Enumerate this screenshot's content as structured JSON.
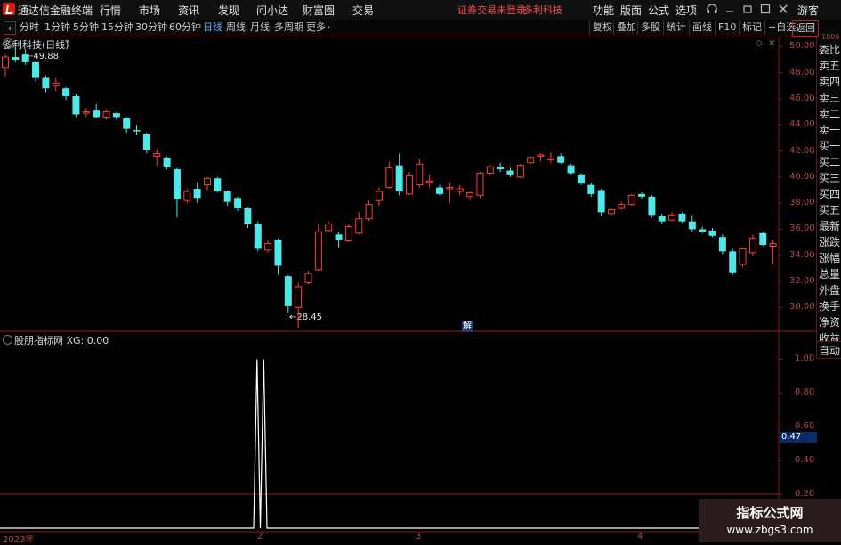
{
  "titlebar": {
    "app_name": "通达信金融终端",
    "menus": [
      "行情",
      "市场",
      "资讯",
      "发现",
      "问小达",
      "财富圈",
      "交易"
    ],
    "warning": "证券交易未登录",
    "stock_name": "多利科技",
    "right_menus": [
      "功能",
      "版面",
      "公式",
      "选项"
    ],
    "guest": "游客",
    "icons": [
      "headset-icon",
      "minimize-icon",
      "restore-icon",
      "close-icon"
    ]
  },
  "toolbar": {
    "back_icon": "‹",
    "periods": [
      "分时",
      "1分钟",
      "5分钟",
      "15分钟",
      "30分钟",
      "60分钟",
      "日线",
      "周线",
      "月线",
      "多周期",
      "更多"
    ],
    "active_period": "日线",
    "right_tools": [
      "复权",
      "叠加",
      "多股",
      "统计",
      "画线",
      "F10",
      "标记",
      "+自选",
      "返回"
    ]
  },
  "main_chart": {
    "title": "多利科技(日线)",
    "high_marker": "49.88",
    "low_marker": "28.45",
    "center_label": "解",
    "y_ticks": [
      "50.00",
      "48.00",
      "46.00",
      "44.00",
      "42.00",
      "40.00",
      "38.00",
      "36.00",
      "34.00",
      "32.00",
      "30.00"
    ]
  },
  "indicator": {
    "title": "股朋指标网 XG: 0.00",
    "y_ticks": [
      "1.00",
      "0.80",
      "0.60",
      "0.40",
      "0.20"
    ],
    "current_value": "0.47"
  },
  "x_axis": {
    "labels": [
      "2023年",
      "2",
      "3",
      "4"
    ]
  },
  "side_panel": {
    "top_label": "1000",
    "items": [
      "委比",
      "卖五",
      "卖四",
      "卖三",
      "卖二",
      "卖一",
      "买一",
      "买二",
      "买三",
      "买四",
      "买五",
      "最新",
      "涨跌",
      "涨幅",
      "总量",
      "外盘",
      "换手",
      "净资",
      "收益"
    ],
    "auto_button": "自动"
  },
  "watermark": {
    "title": "指标公式网",
    "url": "www.zbgs3.com"
  },
  "colors": {
    "up": "#ff3c3c",
    "down": "#4ee8e8",
    "axis": "#8b1a1a",
    "line": "#ffffff"
  },
  "chart_data": [
    {
      "type": "candlestick",
      "title": "多利科技(日线)",
      "ylim": [
        29,
        50.5
      ],
      "candles": [
        {
          "o": 48.4,
          "h": 49.4,
          "l": 47.7,
          "c": 49.2
        },
        {
          "o": 49.2,
          "h": 49.88,
          "l": 48.8,
          "c": 49.0
        },
        {
          "o": 49.4,
          "h": 49.8,
          "l": 48.6,
          "c": 48.8
        },
        {
          "o": 48.8,
          "h": 48.9,
          "l": 47.3,
          "c": 47.6
        },
        {
          "o": 47.6,
          "h": 47.8,
          "l": 46.5,
          "c": 46.8
        },
        {
          "o": 47.0,
          "h": 47.6,
          "l": 46.6,
          "c": 47.2
        },
        {
          "o": 46.8,
          "h": 46.9,
          "l": 45.9,
          "c": 46.2
        },
        {
          "o": 46.2,
          "h": 46.4,
          "l": 44.6,
          "c": 44.8
        },
        {
          "o": 44.9,
          "h": 45.3,
          "l": 44.6,
          "c": 45.0
        },
        {
          "o": 45.1,
          "h": 45.6,
          "l": 44.5,
          "c": 44.6
        },
        {
          "o": 44.6,
          "h": 45.2,
          "l": 44.4,
          "c": 45.0
        },
        {
          "o": 44.9,
          "h": 45.0,
          "l": 44.4,
          "c": 44.6
        },
        {
          "o": 44.5,
          "h": 44.6,
          "l": 43.4,
          "c": 43.7
        },
        {
          "o": 43.6,
          "h": 44.0,
          "l": 43.2,
          "c": 43.5
        },
        {
          "o": 43.3,
          "h": 43.4,
          "l": 41.8,
          "c": 42.1
        },
        {
          "o": 41.6,
          "h": 42.2,
          "l": 40.9,
          "c": 41.8
        },
        {
          "o": 41.5,
          "h": 41.6,
          "l": 40.6,
          "c": 40.8
        },
        {
          "o": 40.6,
          "h": 40.7,
          "l": 36.9,
          "c": 38.3
        },
        {
          "o": 38.2,
          "h": 39.1,
          "l": 38.0,
          "c": 38.9
        },
        {
          "o": 39.1,
          "h": 39.6,
          "l": 38.0,
          "c": 38.4
        },
        {
          "o": 39.4,
          "h": 40.0,
          "l": 39.0,
          "c": 39.9
        },
        {
          "o": 39.9,
          "h": 40.0,
          "l": 38.8,
          "c": 38.9
        },
        {
          "o": 38.9,
          "h": 39.0,
          "l": 37.8,
          "c": 38.1
        },
        {
          "o": 38.4,
          "h": 38.5,
          "l": 37.4,
          "c": 37.6
        },
        {
          "o": 37.6,
          "h": 37.7,
          "l": 36.1,
          "c": 36.4
        },
        {
          "o": 36.4,
          "h": 36.6,
          "l": 34.3,
          "c": 34.5
        },
        {
          "o": 34.4,
          "h": 35.2,
          "l": 34.2,
          "c": 34.9
        },
        {
          "o": 35.2,
          "h": 35.3,
          "l": 32.5,
          "c": 33.2
        },
        {
          "o": 32.4,
          "h": 32.5,
          "l": 29.6,
          "c": 30.1
        },
        {
          "o": 30.0,
          "h": 31.9,
          "l": 28.45,
          "c": 31.6
        },
        {
          "o": 31.9,
          "h": 32.8,
          "l": 31.8,
          "c": 32.6
        },
        {
          "o": 32.9,
          "h": 36.4,
          "l": 32.8,
          "c": 35.8
        },
        {
          "o": 35.9,
          "h": 36.6,
          "l": 35.8,
          "c": 36.4
        },
        {
          "o": 35.6,
          "h": 35.8,
          "l": 34.6,
          "c": 35.2
        },
        {
          "o": 35.1,
          "h": 36.4,
          "l": 35.0,
          "c": 36.2
        },
        {
          "o": 35.7,
          "h": 37.3,
          "l": 35.6,
          "c": 36.8
        },
        {
          "o": 36.8,
          "h": 38.2,
          "l": 36.6,
          "c": 37.9
        },
        {
          "o": 38.2,
          "h": 39.2,
          "l": 37.8,
          "c": 38.9
        },
        {
          "o": 39.2,
          "h": 41.2,
          "l": 39.1,
          "c": 40.7
        },
        {
          "o": 40.9,
          "h": 41.8,
          "l": 38.6,
          "c": 38.9
        },
        {
          "o": 38.7,
          "h": 40.4,
          "l": 38.6,
          "c": 40.1
        },
        {
          "o": 39.4,
          "h": 41.4,
          "l": 39.2,
          "c": 41.0
        },
        {
          "o": 39.6,
          "h": 40.2,
          "l": 39.2,
          "c": 39.7
        },
        {
          "o": 39.2,
          "h": 39.4,
          "l": 38.6,
          "c": 38.7
        },
        {
          "o": 39.1,
          "h": 39.6,
          "l": 38.0,
          "c": 39.2
        },
        {
          "o": 38.9,
          "h": 39.4,
          "l": 38.6,
          "c": 39.1
        },
        {
          "o": 38.5,
          "h": 38.9,
          "l": 38.2,
          "c": 38.8
        },
        {
          "o": 38.6,
          "h": 40.4,
          "l": 38.4,
          "c": 40.3
        },
        {
          "o": 40.3,
          "h": 40.9,
          "l": 40.1,
          "c": 40.8
        },
        {
          "o": 40.8,
          "h": 41.1,
          "l": 40.4,
          "c": 40.6
        },
        {
          "o": 40.5,
          "h": 40.7,
          "l": 40.0,
          "c": 40.2
        },
        {
          "o": 40.0,
          "h": 41.0,
          "l": 39.9,
          "c": 40.9
        },
        {
          "o": 41.1,
          "h": 41.6,
          "l": 41.0,
          "c": 41.5
        },
        {
          "o": 41.6,
          "h": 41.8,
          "l": 41.2,
          "c": 41.7
        },
        {
          "o": 41.4,
          "h": 41.9,
          "l": 41.1,
          "c": 41.4
        },
        {
          "o": 41.6,
          "h": 41.8,
          "l": 41.0,
          "c": 41.1
        },
        {
          "o": 40.9,
          "h": 41.0,
          "l": 40.2,
          "c": 40.3
        },
        {
          "o": 40.2,
          "h": 40.3,
          "l": 39.4,
          "c": 39.5
        },
        {
          "o": 39.4,
          "h": 39.6,
          "l": 38.5,
          "c": 38.7
        },
        {
          "o": 39.0,
          "h": 39.1,
          "l": 37.0,
          "c": 37.3
        },
        {
          "o": 37.2,
          "h": 37.6,
          "l": 37.1,
          "c": 37.5
        },
        {
          "o": 37.6,
          "h": 38.1,
          "l": 37.5,
          "c": 37.9
        },
        {
          "o": 37.9,
          "h": 38.7,
          "l": 37.8,
          "c": 38.6
        },
        {
          "o": 38.7,
          "h": 38.8,
          "l": 38.3,
          "c": 38.5
        },
        {
          "o": 38.5,
          "h": 38.6,
          "l": 36.9,
          "c": 37.1
        },
        {
          "o": 37.0,
          "h": 37.2,
          "l": 36.4,
          "c": 36.6
        },
        {
          "o": 36.7,
          "h": 37.3,
          "l": 36.6,
          "c": 37.1
        },
        {
          "o": 37.2,
          "h": 37.3,
          "l": 36.5,
          "c": 36.6
        },
        {
          "o": 36.6,
          "h": 37.1,
          "l": 35.8,
          "c": 36.0
        },
        {
          "o": 36.0,
          "h": 36.2,
          "l": 35.7,
          "c": 35.8
        },
        {
          "o": 35.9,
          "h": 36.1,
          "l": 35.4,
          "c": 35.5
        },
        {
          "o": 35.4,
          "h": 35.6,
          "l": 34.1,
          "c": 34.3
        },
        {
          "o": 34.3,
          "h": 34.5,
          "l": 32.5,
          "c": 32.7
        },
        {
          "o": 33.3,
          "h": 34.6,
          "l": 33.1,
          "c": 34.5
        },
        {
          "o": 34.2,
          "h": 35.6,
          "l": 33.9,
          "c": 35.3
        },
        {
          "o": 35.7,
          "h": 35.8,
          "l": 34.7,
          "c": 34.8
        },
        {
          "o": 34.7,
          "h": 35.2,
          "l": 33.3,
          "c": 34.9
        }
      ]
    },
    {
      "type": "line",
      "title": "股朋指标网 XG: 0.00",
      "ylim": [
        0,
        1.05
      ],
      "series": [
        {
          "name": "XG",
          "values": [
            0,
            0,
            0,
            0,
            0,
            0,
            0,
            0,
            0,
            0,
            0,
            0,
            0,
            0,
            0,
            0,
            0,
            0,
            0,
            0,
            0,
            0,
            0,
            0,
            0,
            0,
            0,
            0,
            0,
            0,
            0,
            0,
            0,
            0,
            0,
            0,
            0,
            0,
            0,
            0,
            0,
            0,
            0,
            0,
            0,
            0,
            0,
            0,
            0,
            0,
            0,
            0,
            0,
            0,
            0,
            0,
            0,
            0,
            0,
            0,
            0,
            0,
            0,
            0,
            0,
            0,
            0,
            0,
            0,
            0,
            0,
            0,
            0,
            0,
            0,
            0,
            0,
            1,
            0,
            1,
            0,
            0,
            0,
            0,
            0,
            0,
            0,
            0,
            0,
            0,
            0,
            0,
            0,
            0,
            0,
            0,
            0,
            0,
            0,
            0,
            0,
            0,
            0,
            0,
            0,
            0,
            0,
            0,
            0,
            0,
            0,
            0,
            0,
            0,
            0,
            0,
            0,
            0,
            0,
            0,
            0,
            0,
            0,
            0,
            0,
            0,
            0,
            0,
            0,
            0,
            0,
            0,
            0,
            0,
            0,
            0,
            0,
            0,
            0,
            0,
            0,
            0,
            0,
            0,
            0,
            0,
            0,
            0,
            0,
            0,
            0,
            0,
            0,
            0,
            0,
            0,
            0,
            0,
            0,
            0,
            0,
            0,
            0,
            0,
            0,
            0,
            0,
            0,
            0,
            0,
            0,
            0,
            0,
            0,
            0,
            0,
            0,
            0,
            0,
            0,
            0,
            0,
            0,
            0,
            0,
            0,
            0,
            0,
            0,
            0,
            0,
            0,
            0,
            0,
            0,
            0,
            0,
            0,
            0,
            0,
            0,
            0,
            0,
            0,
            0,
            0,
            0,
            0,
            0,
            0,
            0,
            0,
            0,
            0,
            0,
            0,
            0,
            0,
            0,
            0,
            0,
            0,
            0,
            0,
            0,
            0,
            0,
            0,
            0,
            0,
            0,
            0,
            0
          ]
        }
      ],
      "y_ticks": [
        "1.00",
        "0.80",
        "0.60",
        "0.40",
        "0.20"
      ]
    }
  ]
}
